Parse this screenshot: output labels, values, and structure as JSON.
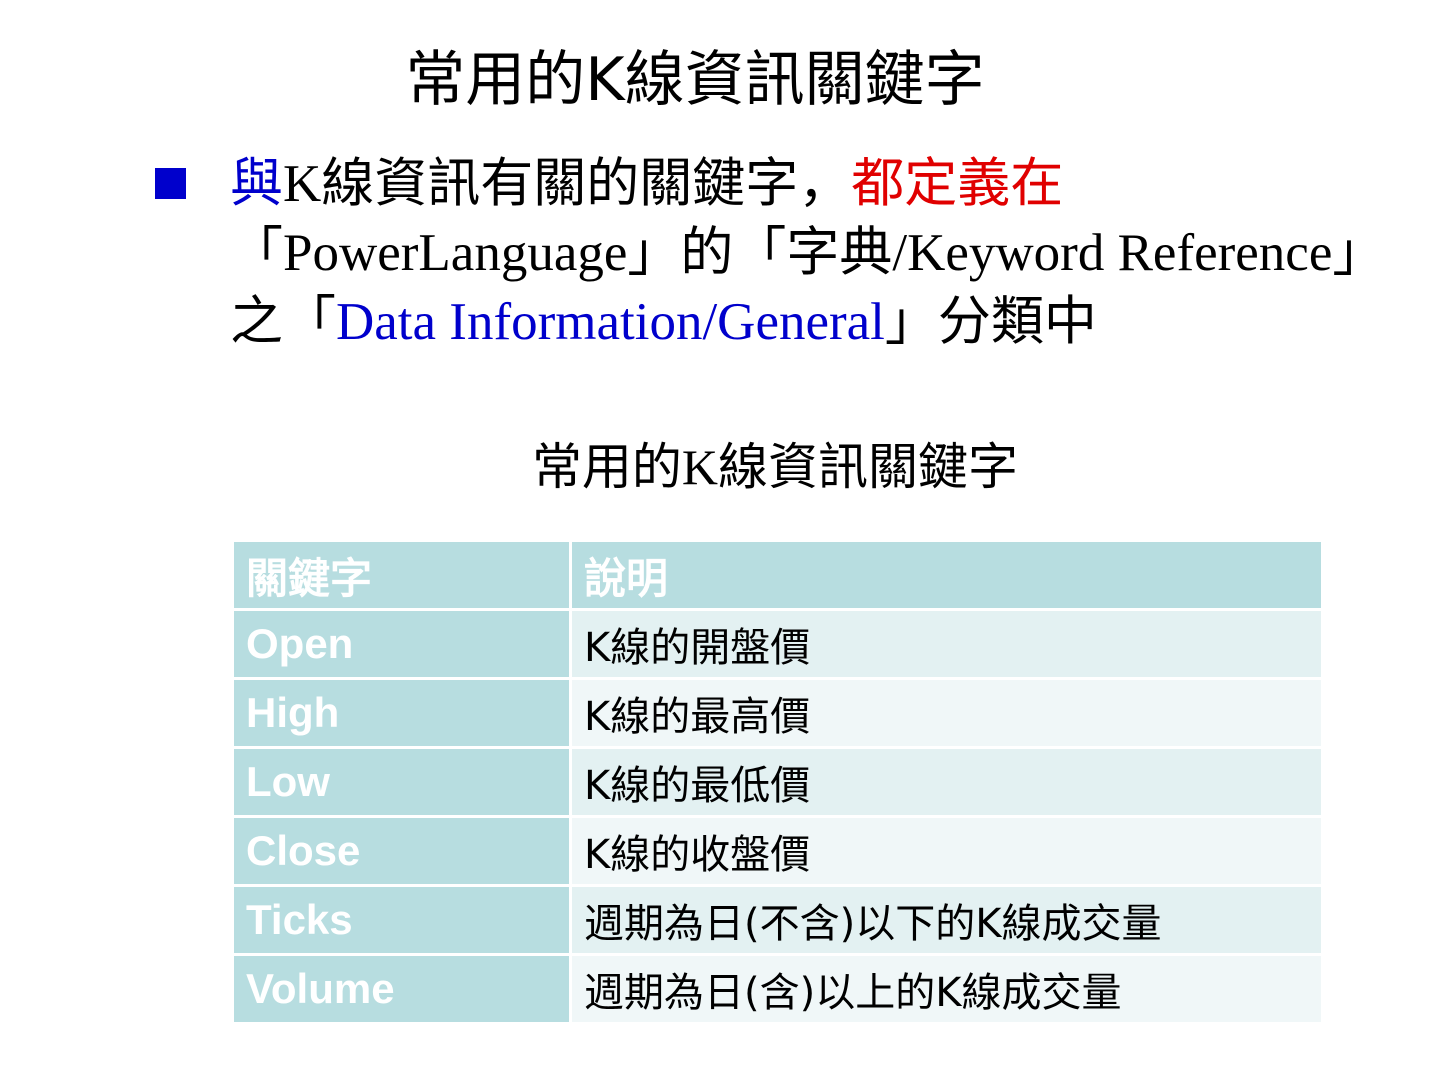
{
  "title": "常用的K線資訊關鍵字",
  "bullet": {
    "part1": "與",
    "part2": "K線資訊有關的關鍵字，",
    "part3": "都定義在",
    "part4": "「PowerLanguage」的「字典/Keyword Reference」之「",
    "part5": "Data Information/General",
    "part6": "」分類中"
  },
  "table": {
    "caption": "常用的K線資訊關鍵字",
    "headers": [
      "關鍵字",
      "說明"
    ],
    "rows": [
      {
        "keyword": "Open",
        "description": "K線的開盤價"
      },
      {
        "keyword": "High",
        "description": "K線的最高價"
      },
      {
        "keyword": "Low",
        "description": "K線的最低價"
      },
      {
        "keyword": "Close",
        "description": "K線的收盤價"
      },
      {
        "keyword": "Ticks",
        "description": "週期為日(不含)以下的K線成交量"
      },
      {
        "keyword": "Volume",
        "description": "週期為日(含)以上的K線成交量"
      }
    ]
  },
  "colors": {
    "bullet_blue": "#0000cc",
    "highlight_red": "#e00000",
    "table_header_bg": "#b7dde0",
    "row_band_1": "#e3f1f2",
    "row_band_2": "#f0f7f8"
  }
}
